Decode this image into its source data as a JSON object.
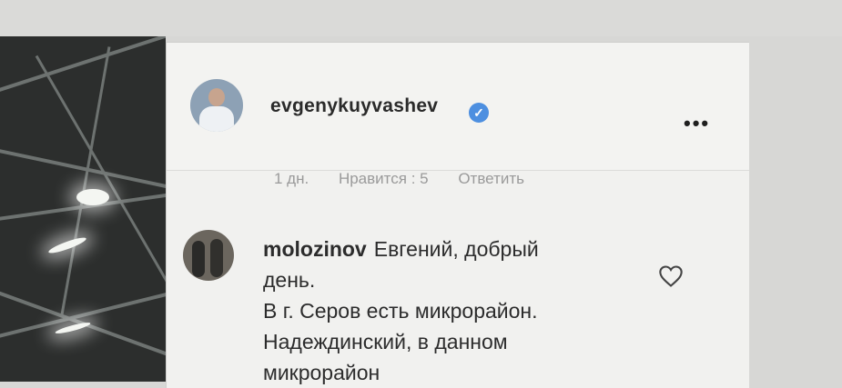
{
  "post": {
    "username": "evgenykuyvashev",
    "verified_icon": "verified-badge-icon",
    "more_label": "•••",
    "meta": {
      "time": "1 дн.",
      "likes": "Нравится : 5",
      "reply": "Ответить"
    }
  },
  "comment": {
    "username": "molozinov",
    "lines": [
      "Евгений, добрый",
      "день.",
      "В г. Серов есть микрорайон.",
      "Надеждинский, в данном",
      "микрорайон"
    ],
    "like_icon": "heart-icon"
  },
  "colors": {
    "verified": "#4d8fe0",
    "panel_bg": "#f1f1ef"
  }
}
